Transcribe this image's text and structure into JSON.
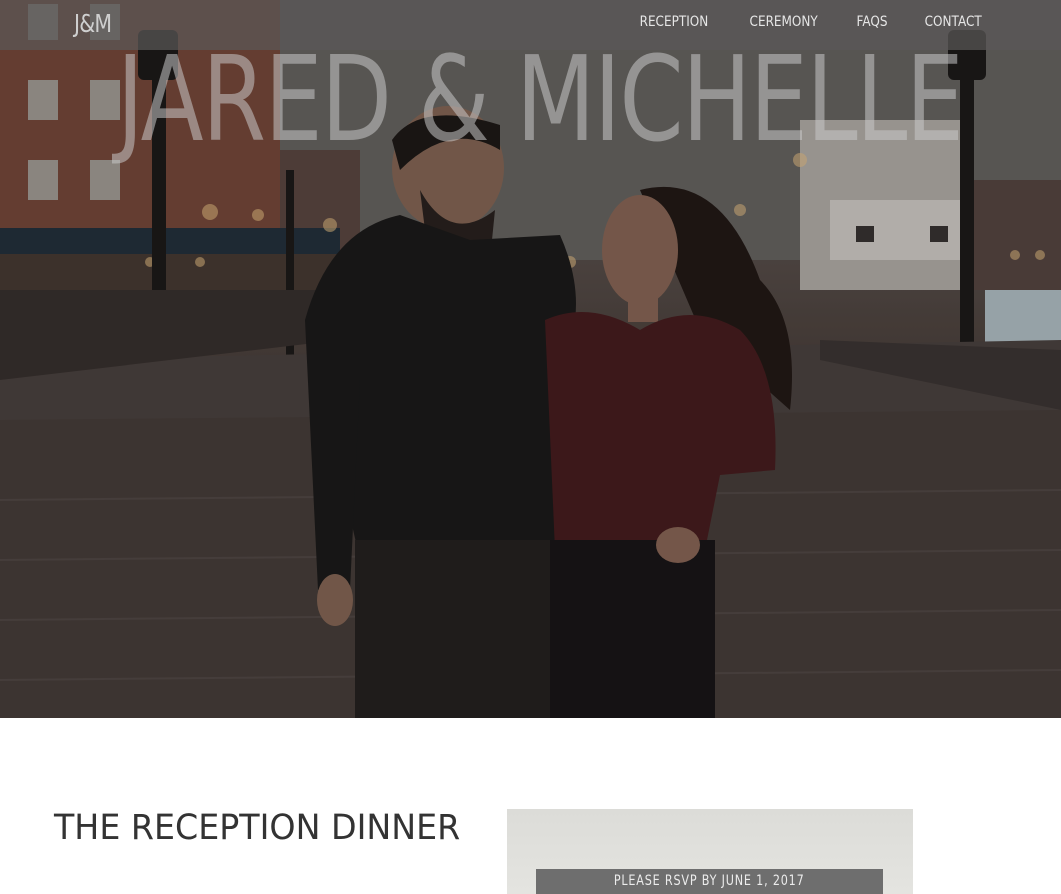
{
  "nav": {
    "brand": "J&M",
    "links": [
      "RECEPTION",
      "CEREMONY",
      "FAQS",
      "CONTACT"
    ]
  },
  "hero": {
    "title": "JARED & MICHELLE"
  },
  "reception": {
    "heading": "THE RECEPTION DINNER",
    "rsvp_text": "PLEASE RSVP BY JUNE 1, 2017"
  }
}
